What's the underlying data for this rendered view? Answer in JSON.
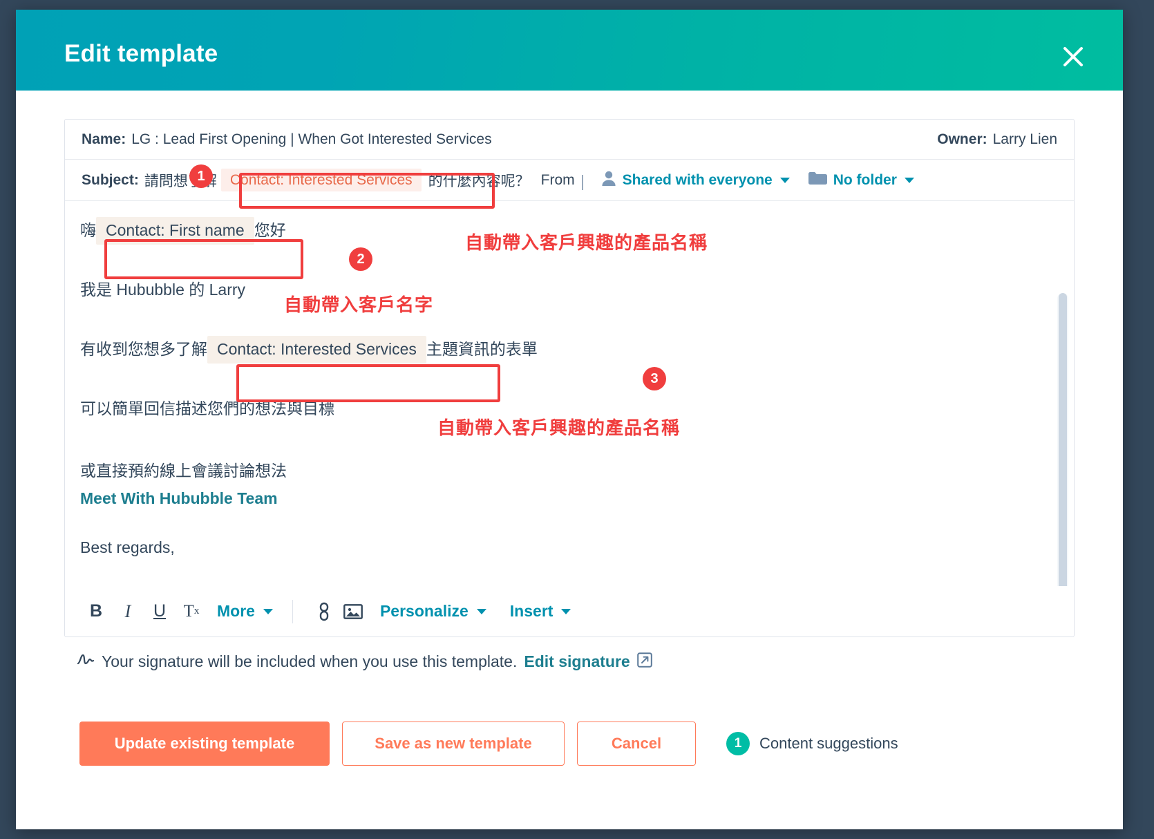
{
  "window": {
    "title": "Edit template",
    "close_icon": "close-icon"
  },
  "meta": {
    "name_label": "Name:",
    "name_value": "LG : Lead First Opening | When Got Interested Services",
    "owner_label": "Owner:",
    "owner_value": "Larry Lien",
    "subject_label": "Subject:",
    "subject_prefix": "請問想了解",
    "subject_token": "Contact: Interested Services",
    "subject_suffix": "的什麼內容呢？",
    "from_label": "From",
    "sharing_icon": "person-icon",
    "sharing_value": "Shared with everyone",
    "folder_icon": "folder-icon",
    "folder_value": "No folder"
  },
  "body": {
    "line1_prefix": "嗨",
    "line1_token": "Contact: First name",
    "line1_suffix": "您好",
    "line2": "我是 Hububble 的 Larry",
    "line3_prefix": "有收到您想多了解",
    "line3_token": "Contact: Interested Services",
    "line3_suffix": "主題資訊的表單",
    "line4": "可以簡單回信描述您們的想法與目標",
    "line5": "或直接預約線上會議討論想法",
    "link": "Meet With Hububble Team",
    "line6": "Best regards,"
  },
  "toolbar": {
    "bold": "B",
    "italic": "I",
    "underline": "U",
    "clear_format": "T",
    "clear_format_sub": "x",
    "more": "More",
    "link_icon": "link-icon",
    "image_icon": "image-icon",
    "personalize": "Personalize",
    "insert": "Insert"
  },
  "signature": {
    "icon": "signature-icon",
    "text": "Your signature will be included when you use this template.",
    "link": "Edit signature",
    "external_icon": "external-link-icon"
  },
  "footer": {
    "update_button": "Update existing template",
    "save_new_button": "Save as new template",
    "cancel_button": "Cancel",
    "suggestions_count": "1",
    "suggestions_label": "Content suggestions"
  },
  "annotations": {
    "badge1": "1",
    "badge2": "2",
    "badge3": "3",
    "note_subject": "自動帶入客戶興趣的產品名稱",
    "note_firstname": "自動帶入客戶名字",
    "note_interested": "自動帶入客戶興趣的產品名稱"
  },
  "colors": {
    "header_start": "#00a1b6",
    "header_end": "#00bda0",
    "accent_orange": "#ff7a59",
    "link_teal": "#0091ae",
    "annotation_red": "#f03e3e",
    "text_dark": "#33475b",
    "token_orange_bg": "#fdeeea",
    "token_beige_bg": "#f7f0e9",
    "suggestion_green": "#00bda5"
  }
}
